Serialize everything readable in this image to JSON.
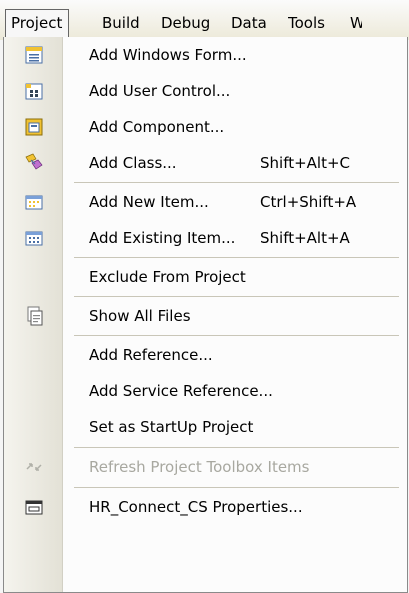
{
  "menubar": {
    "items": [
      "Project",
      "Build",
      "Debug",
      "Data",
      "Tools",
      "W"
    ]
  },
  "dropdown": {
    "items": [
      {
        "label": "Add Windows Form...",
        "shortcut": "",
        "icon": "windows-form-icon"
      },
      {
        "label": "Add User Control...",
        "shortcut": "",
        "icon": "user-control-icon"
      },
      {
        "label": "Add Component...",
        "shortcut": "",
        "icon": "component-icon"
      },
      {
        "label": "Add Class...",
        "shortcut": "Shift+Alt+C",
        "icon": "class-icon"
      },
      {
        "label": "Add New Item...",
        "shortcut": "Ctrl+Shift+A",
        "icon": "new-item-icon"
      },
      {
        "label": "Add Existing Item...",
        "shortcut": "Shift+Alt+A",
        "icon": "existing-item-icon"
      },
      {
        "label": "Exclude From Project",
        "shortcut": "",
        "icon": ""
      },
      {
        "label": "Show All Files",
        "shortcut": "",
        "icon": "show-all-files-icon"
      },
      {
        "label": "Add Reference...",
        "shortcut": "",
        "icon": ""
      },
      {
        "label": "Add Service Reference...",
        "shortcut": "",
        "icon": ""
      },
      {
        "label": "Set as StartUp Project",
        "shortcut": "",
        "icon": ""
      },
      {
        "label": "Refresh Project Toolbox Items",
        "shortcut": "",
        "icon": "refresh-toolbox-icon",
        "disabled": true
      },
      {
        "label": "HR_Connect_CS Properties...",
        "shortcut": "",
        "icon": "properties-icon"
      }
    ]
  }
}
